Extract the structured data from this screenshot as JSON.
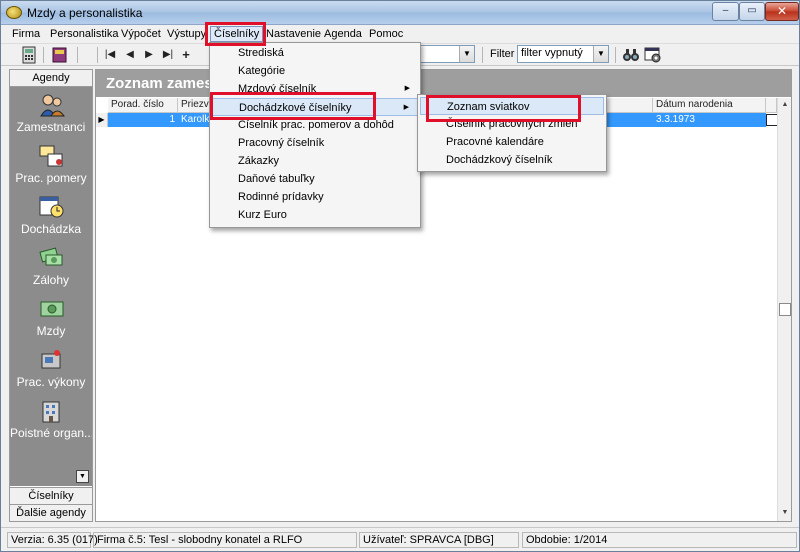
{
  "window": {
    "title": "Mzdy a personalistika",
    "controls": {
      "minimize": "–",
      "maximize": "▭",
      "close": "✕"
    }
  },
  "menubar": {
    "items": [
      "Firma",
      "Personalistika",
      "Výpočet",
      "Výstupy",
      "Číselníky",
      "Nastavenie",
      "Agenda",
      "Pomoc"
    ],
    "active": "Číselníky"
  },
  "toolbar": {
    "nav_glyphs": [
      "|◀",
      "◀",
      "▶",
      "▶|",
      "+"
    ],
    "filter_label": "Filter",
    "filter_value": "filter vypnutý",
    "combo_value": ""
  },
  "sidebar": {
    "header": "Agendy",
    "items": [
      "Zamestnanci",
      "Prac. pomery",
      "Dochádzka",
      "Zálohy",
      "Mzdy",
      "Prac. výkony",
      "Poistné organ..."
    ],
    "footer": [
      "Číselníky",
      "Ďalšie agendy"
    ]
  },
  "main": {
    "title": "Zoznam zames",
    "columns": [
      "Porad. číslo",
      "Priezvis",
      "Dátum narodenia"
    ],
    "rows": [
      {
        "porad_cislo": "1",
        "priezvisko": "Karolko",
        "datum_narodenia": "3.3.1973"
      }
    ]
  },
  "ciselniky_menu": {
    "items": [
      "Strediská",
      "Kategórie",
      "Mzdový číselník",
      "Dochádzkové číselníky",
      "Číselník prac. pomerov a dohôd",
      "Pracovný číselník",
      "Zákazky",
      "Daňové tabuľky",
      "Rodinné prídavky",
      "Kurz Euro"
    ],
    "highlighted": "Dochádzkové číselníky"
  },
  "dochadzkove_submenu": {
    "items": [
      "Zoznam sviatkov",
      "Číselník pracovných zmien",
      "Pracovné kalendáre",
      "Dochádzkový číselník"
    ],
    "highlighted": "Zoznam sviatkov"
  },
  "statusbar": {
    "version": "Verzia: 6.35 (017)",
    "firma": "Firma č.5: Tesl - slobodny konatel a RLFO",
    "user": "Užívateľ: SPRAVCA [DBG]",
    "period": "Obdobie: 1/2014"
  },
  "colors": {
    "highlight_box": "#e0102a",
    "selected_row": "#3399ff",
    "sidebar_bg": "#8c8c8c",
    "header_bg": "#9e9e9e"
  }
}
